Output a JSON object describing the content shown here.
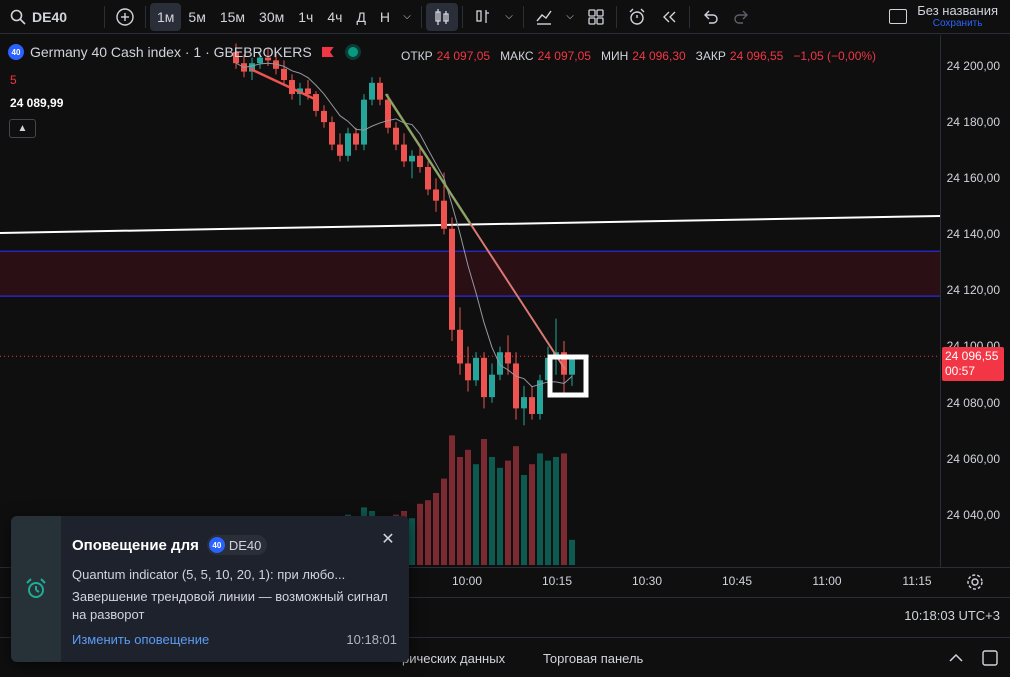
{
  "toolbar": {
    "symbol": "DE40",
    "timeframes": [
      "1м",
      "5м",
      "15м",
      "30м",
      "1ч",
      "4ч",
      "Д",
      "Н"
    ],
    "active_timeframe": "1м",
    "layout_name": "Без названия",
    "save_label": "Сохранить"
  },
  "legend": {
    "badge": "40",
    "title": "Germany 40 Cash index · 1 · GBEBROKERS",
    "ohlc": [
      {
        "k": "ОТКР",
        "v": "24 097,05"
      },
      {
        "k": "МАКС",
        "v": "24 097,05"
      },
      {
        "k": "МИН",
        "v": "24 096,30"
      },
      {
        "k": "ЗАКР",
        "v": "24 096,55"
      }
    ],
    "change": "−1,05 (−0,00%)",
    "indicator_num": "5",
    "indicator_value": "24 089,99"
  },
  "price_axis": {
    "ticks": [
      "24 200,00",
      "24 180,00",
      "24 160,00",
      "24 140,00",
      "24 120,00",
      "24 100,00",
      "24 080,00",
      "24 060,00",
      "24 040,00"
    ],
    "current_price": "24 096,55",
    "countdown": "00:57"
  },
  "time_axis": {
    "ticks": [
      "10:00",
      "10:15",
      "10:30",
      "10:45",
      "11:00",
      "11:15"
    ]
  },
  "status": {
    "clock": "10:18:03 UTC+3"
  },
  "bottom_tabs": {
    "tab1": "рических данных",
    "tab2": "Торговая панель"
  },
  "alert": {
    "title": "Оповещение для",
    "symbol": "DE40",
    "badge": "40",
    "line1": "Quantum indicator (5, 5, 10, 20, 1): при любо...",
    "line2": "Завершение трендовой линии — возможный сигнал на разворот",
    "edit_label": "Изменить оповещение",
    "time": "10:18:01"
  },
  "chart_data": {
    "type": "candlestick",
    "ylim": [
      24020,
      24210
    ],
    "candles": [
      {
        "o": 24205,
        "h": 24208,
        "l": 24199,
        "c": 24201
      },
      {
        "o": 24201,
        "h": 24204,
        "l": 24196,
        "c": 24198
      },
      {
        "o": 24198,
        "h": 24203,
        "l": 24195,
        "c": 24201
      },
      {
        "o": 24201,
        "h": 24205,
        "l": 24199,
        "c": 24203
      },
      {
        "o": 24203,
        "h": 24206,
        "l": 24200,
        "c": 24202
      },
      {
        "o": 24202,
        "h": 24205,
        "l": 24197,
        "c": 24199
      },
      {
        "o": 24199,
        "h": 24202,
        "l": 24193,
        "c": 24195
      },
      {
        "o": 24195,
        "h": 24197,
        "l": 24188,
        "c": 24190
      },
      {
        "o": 24190,
        "h": 24194,
        "l": 24186,
        "c": 24192
      },
      {
        "o": 24192,
        "h": 24195,
        "l": 24188,
        "c": 24190
      },
      {
        "o": 24190,
        "h": 24191,
        "l": 24182,
        "c": 24184
      },
      {
        "o": 24184,
        "h": 24186,
        "l": 24178,
        "c": 24180
      },
      {
        "o": 24180,
        "h": 24182,
        "l": 24170,
        "c": 24172
      },
      {
        "o": 24172,
        "h": 24176,
        "l": 24166,
        "c": 24168
      },
      {
        "o": 24168,
        "h": 24178,
        "l": 24166,
        "c": 24176
      },
      {
        "o": 24176,
        "h": 24178,
        "l": 24170,
        "c": 24172
      },
      {
        "o": 24172,
        "h": 24190,
        "l": 24170,
        "c": 24188
      },
      {
        "o": 24188,
        "h": 24196,
        "l": 24186,
        "c": 24194
      },
      {
        "o": 24194,
        "h": 24196,
        "l": 24186,
        "c": 24188
      },
      {
        "o": 24188,
        "h": 24190,
        "l": 24176,
        "c": 24178
      },
      {
        "o": 24178,
        "h": 24180,
        "l": 24170,
        "c": 24172
      },
      {
        "o": 24172,
        "h": 24176,
        "l": 24164,
        "c": 24166
      },
      {
        "o": 24166,
        "h": 24170,
        "l": 24160,
        "c": 24168
      },
      {
        "o": 24168,
        "h": 24172,
        "l": 24162,
        "c": 24164
      },
      {
        "o": 24164,
        "h": 24166,
        "l": 24154,
        "c": 24156
      },
      {
        "o": 24156,
        "h": 24160,
        "l": 24148,
        "c": 24152
      },
      {
        "o": 24152,
        "h": 24162,
        "l": 24140,
        "c": 24142
      },
      {
        "o": 24142,
        "h": 24146,
        "l": 24102,
        "c": 24106
      },
      {
        "o": 24106,
        "h": 24114,
        "l": 24090,
        "c": 24094
      },
      {
        "o": 24094,
        "h": 24100,
        "l": 24084,
        "c": 24088
      },
      {
        "o": 24088,
        "h": 24098,
        "l": 24086,
        "c": 24096
      },
      {
        "o": 24096,
        "h": 24098,
        "l": 24078,
        "c": 24082
      },
      {
        "o": 24082,
        "h": 24094,
        "l": 24080,
        "c": 24090
      },
      {
        "o": 24090,
        "h": 24100,
        "l": 24088,
        "c": 24098
      },
      {
        "o": 24098,
        "h": 24104,
        "l": 24090,
        "c": 24094
      },
      {
        "o": 24094,
        "h": 24098,
        "l": 24074,
        "c": 24078
      },
      {
        "o": 24078,
        "h": 24086,
        "l": 24072,
        "c": 24082
      },
      {
        "o": 24082,
        "h": 24086,
        "l": 24074,
        "c": 24076
      },
      {
        "o": 24076,
        "h": 24090,
        "l": 24074,
        "c": 24088
      },
      {
        "o": 24088,
        "h": 24100,
        "l": 24086,
        "c": 24096
      },
      {
        "o": 24096,
        "h": 24110,
        "l": 24090,
        "c": 24098
      },
      {
        "o": 24098,
        "h": 24102,
        "l": 24082,
        "c": 24090
      },
      {
        "o": 24090,
        "h": 24097,
        "l": 24086,
        "c": 24096
      }
    ],
    "volume": [
      12,
      14,
      10,
      16,
      12,
      14,
      18,
      20,
      15,
      17,
      22,
      24,
      26,
      20,
      28,
      18,
      32,
      30,
      24,
      26,
      28,
      30,
      26,
      34,
      36,
      40,
      48,
      72,
      60,
      64,
      56,
      70,
      60,
      54,
      58,
      66,
      50,
      56,
      62,
      58,
      60,
      62,
      14
    ],
    "volume_up": [
      false,
      false,
      true,
      true,
      false,
      false,
      false,
      false,
      true,
      false,
      false,
      false,
      false,
      false,
      true,
      false,
      true,
      true,
      false,
      false,
      false,
      false,
      true,
      false,
      false,
      false,
      false,
      false,
      false,
      false,
      true,
      false,
      true,
      true,
      false,
      false,
      true,
      false,
      true,
      true,
      true,
      false,
      true
    ],
    "horizontal_lines": [
      {
        "price": 24134,
        "color": "#2a2ae0"
      },
      {
        "price": 24118,
        "color": "#2a2ae0"
      }
    ],
    "current_price": 24096.55
  }
}
